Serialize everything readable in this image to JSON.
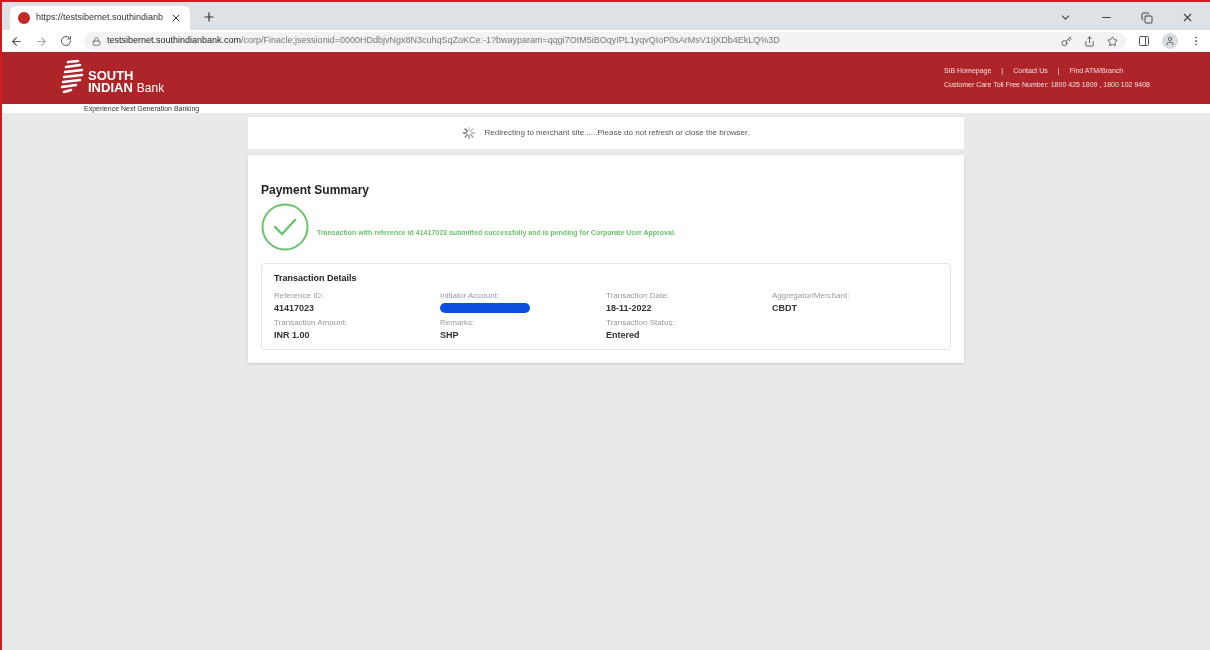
{
  "browser": {
    "tab_title": "https://testsibernet.southindianb",
    "url_host": "testsibernet.southindianbank.com",
    "url_path": "/corp/Finacle;jsessionid=0000HDdbjvNgx8N3cuhqSqZoKCe:-1?bwayparam=qqgi7OtM5iBOqyIPL1yqvQIoP0sArMsV1IjXDb4EkLQ%3D"
  },
  "header": {
    "logo_line1": "SOUTH",
    "logo_line2": "INDIAN",
    "logo_word": "Bank",
    "tagline": "Experience Next Generation Banking",
    "links": [
      "SIB Homepage",
      "Contact Us",
      "Find ATM/Branch"
    ],
    "separator": "|",
    "customer_care": "Customer Care Toll Free Number: 1800 425 1809 , 1800 102 9408"
  },
  "notice": "Redirecting to merchant site .....Please do not refresh or close the browser.",
  "summary": {
    "title": "Payment Summary",
    "message": "Transaction with reference id 41417023 submitted successfully and is pending for Corporate User Approval.",
    "details_title": "Transaction Details",
    "fields": [
      {
        "label": "Reference ID:",
        "value": "41417023",
        "redacted": false
      },
      {
        "label": "Initiator Account:",
        "redacted": true
      },
      {
        "label": "Transaction Date:",
        "value": "18-11-2022",
        "redacted": false
      },
      {
        "label": "Aggregator/Merchant:",
        "value": "CBDT",
        "redacted": false
      },
      {
        "label": "Transaction Amount:",
        "value": "INR 1.00",
        "redacted": false
      },
      {
        "label": "Remarks:",
        "value": "SHP",
        "redacted": false
      },
      {
        "label": "Transaction Status:",
        "value": "Entered",
        "redacted": false
      }
    ]
  }
}
